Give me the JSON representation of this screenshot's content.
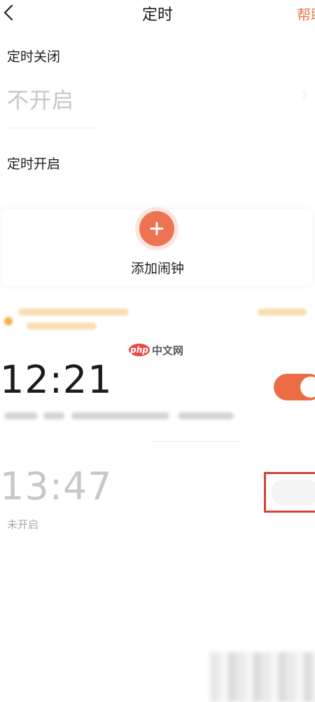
{
  "header": {
    "title": "定时",
    "help_label": "帮助",
    "back_icon": "chevron-left-icon",
    "accent_color": "#f07a4b"
  },
  "timer_off": {
    "label": "定时关闭",
    "value": "不开启"
  },
  "timer_on": {
    "label": "定时开启"
  },
  "add_alarm": {
    "label": "添加闹钟",
    "icon": "plus-icon",
    "button_color": "#ee7352"
  },
  "watermark": {
    "badge_text": "php",
    "site_text": "中文网"
  },
  "alarms": [
    {
      "time": "12:21",
      "enabled": true
    },
    {
      "time": "13:47",
      "enabled": false,
      "status": "未开启"
    }
  ],
  "toggle_on_color": "#ee6c45",
  "highlight_color": "#d0453c"
}
